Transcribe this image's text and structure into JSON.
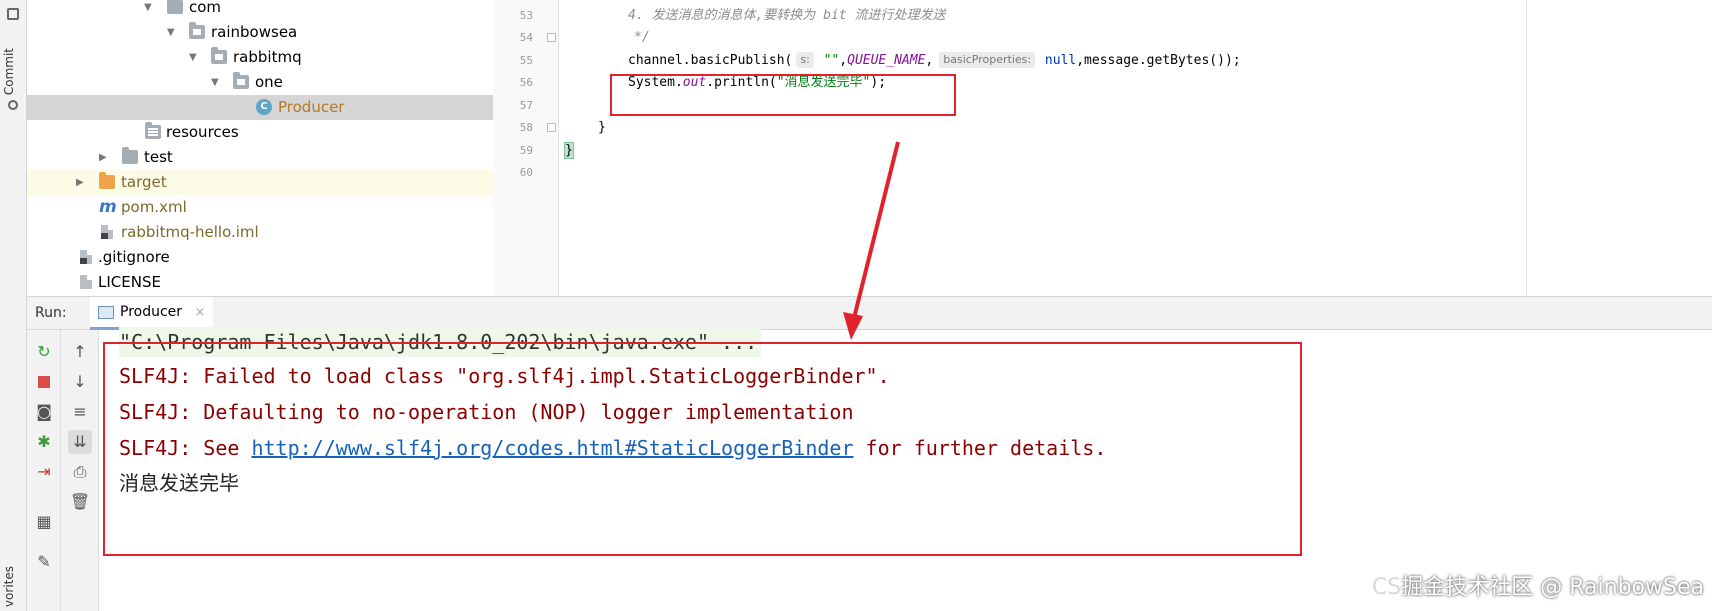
{
  "left_strip": {
    "commit_label": "Commit",
    "favorites_label": "vorites"
  },
  "project_tree": {
    "items": [
      {
        "label": "com",
        "icon": "folder-icon"
      },
      {
        "label": "rainbowsea",
        "icon": "folder-icon"
      },
      {
        "label": "rabbitmq",
        "icon": "folder-icon"
      },
      {
        "label": "one",
        "icon": "folder-icon"
      },
      {
        "label": "Producer",
        "icon": "java-class-icon",
        "icon_letter": "C"
      },
      {
        "label": "resources",
        "icon": "resources-folder-icon"
      },
      {
        "label": "test",
        "icon": "folder-icon"
      },
      {
        "label": "target",
        "icon": "excluded-folder-icon"
      },
      {
        "label": "pom.xml",
        "icon": "maven-icon",
        "icon_letter": "m"
      },
      {
        "label": "rabbitmq-hello.iml",
        "icon": "iml-file-icon"
      },
      {
        "label": ".gitignore",
        "icon": "text-file-icon"
      },
      {
        "label": "LICENSE",
        "icon": "text-file-icon"
      }
    ]
  },
  "editor": {
    "line_numbers": [
      "53",
      "54",
      "55",
      "56",
      "57",
      "58",
      "59",
      "60"
    ],
    "line53_comment": "4. 发送消息的消息体,要转换为 bit 流进行处理发送",
    "line54_comment": "*/",
    "line55": {
      "prefix": "channel.basicPublish(",
      "hint_s": "s:",
      "empty_str": " \"\"",
      "comma1": ",",
      "queue_const": "QUEUE_NAME",
      "comma2": ",",
      "hint_props": "basicProperties:",
      "null_kw": " null",
      "suffix": ",message.getBytes());"
    },
    "line56": {
      "prefix": "System.",
      "out_field": "out",
      "call": ".println(",
      "msg_str": "\"消息发送完毕\"",
      "suffix": ");"
    },
    "line58": "}",
    "line59": "}"
  },
  "run_panel": {
    "label": "Run:",
    "tab_label": "Producer",
    "tab_close": "×",
    "console_lines": {
      "l1": "\"C:\\Program Files\\Java\\jdk1.8.0_202\\bin\\java.exe\" ...",
      "l2": "SLF4J: Failed to load class \"org.slf4j.impl.StaticLoggerBinder\".",
      "l3": "SLF4J: Defaulting to no-operation (NOP) logger implementation",
      "l4_prefix": "SLF4J: See ",
      "l4_link": "http://www.slf4j.org/codes.html#StaticLoggerBinder",
      "l4_suffix": " for further details.",
      "l5": "消息发送完毕"
    }
  },
  "watermark": {
    "ghost": "CS",
    "text": "掘金技术社区 @ RainbowSea"
  },
  "colors": {
    "annotation_red": "#e0222c",
    "console_error": "#8b0000",
    "link_blue": "#1762b8",
    "string_green": "#067d17",
    "constant_purple": "#871094"
  }
}
